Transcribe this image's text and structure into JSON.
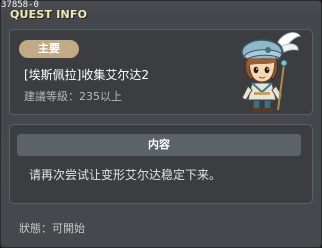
{
  "window": {
    "id_tag": "37858-0",
    "title": "QUEST INFO",
    "close_glyph": "✕"
  },
  "quest": {
    "category": "主要",
    "name": "[埃斯佩拉]收集艾尔达2",
    "level_requirement": "建議等級：235以上"
  },
  "content": {
    "header": "内容",
    "text": "请再次尝试让变形艾尔达稳定下来。"
  },
  "status": {
    "text": "狀態：可開始"
  },
  "colors": {
    "title": "#f4e9b4",
    "badge": "#c2a987",
    "panel": "#3b3d41",
    "content_header": "#5b6268"
  },
  "icons": {
    "npc": "npc-portrait-icon",
    "close": "close-icon"
  }
}
